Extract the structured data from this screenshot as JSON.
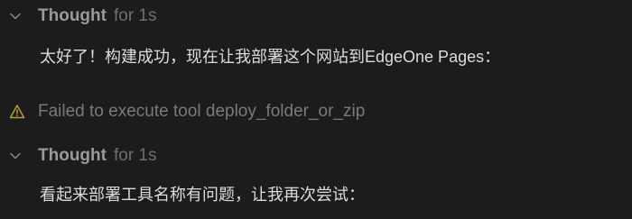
{
  "blocks": [
    {
      "title": "Thought",
      "suffix": "for 1s",
      "message": "太好了！构建成功，现在让我部署这个网站到EdgeOne Pages："
    },
    {
      "title": "Thought",
      "suffix": "for 1s",
      "message": "看起来部署工具名称有问题，让我再次尝试："
    }
  ],
  "warning": {
    "text": "Failed to execute tool deploy_folder_or_zip",
    "icon": "warning-triangle-icon"
  },
  "colors": {
    "background": "#1c1c1c",
    "muted": "#7a7a7a",
    "text": "#dcdcdc"
  }
}
